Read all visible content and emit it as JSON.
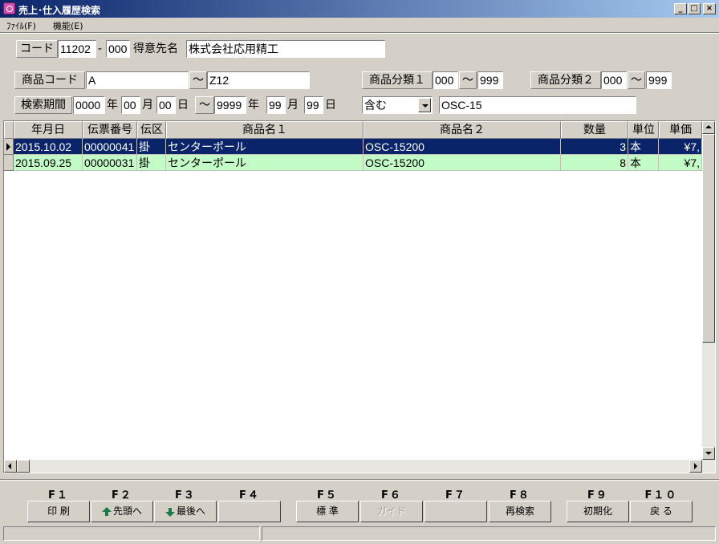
{
  "window": {
    "title": "売上･仕入履歴検索",
    "icons": {
      "app": "app-icon",
      "minimize": "minimize-icon",
      "maximize": "maximize-icon",
      "close": "close-icon"
    }
  },
  "menu": [
    "ﾌｧｲﾙ(F)",
    "機能(E)"
  ],
  "customer": {
    "code_label": "コード",
    "code": "11202",
    "dash": "-",
    "branch": "000",
    "name_label": "得意先名",
    "name": "株式会社応用精工"
  },
  "product": {
    "code_label": "商品コード",
    "from": "A",
    "tilde": "～",
    "to": "Z12",
    "class1_label": "商品分類１",
    "class1_from": "000",
    "class1_to": "999",
    "class2_label": "商品分類２",
    "class2_from": "000",
    "class2_to": "999"
  },
  "period": {
    "label": "検索期間",
    "from_year": "0000",
    "from_month": "00",
    "from_day": "00",
    "to_year": "9999",
    "to_month": "99",
    "to_day": "99",
    "year": "年",
    "month": "月",
    "day": "日",
    "tilde": "～",
    "match_mode": "含む",
    "keyword": "OSC-15"
  },
  "grid": {
    "columns": [
      "年月日",
      "伝票番号",
      "伝区",
      "商品名１",
      "商品名２",
      "数量",
      "単位",
      "単価"
    ],
    "rows": [
      [
        "2015.10.02",
        "00000041",
        "掛",
        "センターポール",
        "OSC-15200",
        "3",
        "本",
        "¥7,"
      ],
      [
        "2015.09.25",
        "00000031",
        "掛",
        "センターポール",
        "OSC-15200",
        "8",
        "本",
        "¥7,"
      ]
    ]
  },
  "fkeys": [
    {
      "key": "F１",
      "label": "印 刷",
      "enabled": true
    },
    {
      "key": "F２",
      "label": "先頭へ",
      "enabled": true,
      "icon": "arrow-up-icon"
    },
    {
      "key": "F３",
      "label": "最後へ",
      "enabled": true,
      "icon": "arrow-down-icon"
    },
    {
      "key": "F４",
      "label": "",
      "enabled": true
    },
    {
      "key": "F５",
      "label": "標 準",
      "enabled": true
    },
    {
      "key": "F６",
      "label": "ガイド",
      "enabled": false
    },
    {
      "key": "F７",
      "label": "",
      "enabled": true
    },
    {
      "key": "F８",
      "label": "再検索",
      "enabled": true
    },
    {
      "key": "F９",
      "label": "初期化",
      "enabled": true
    },
    {
      "key": "F１０",
      "label": "戻 る",
      "enabled": true
    }
  ]
}
